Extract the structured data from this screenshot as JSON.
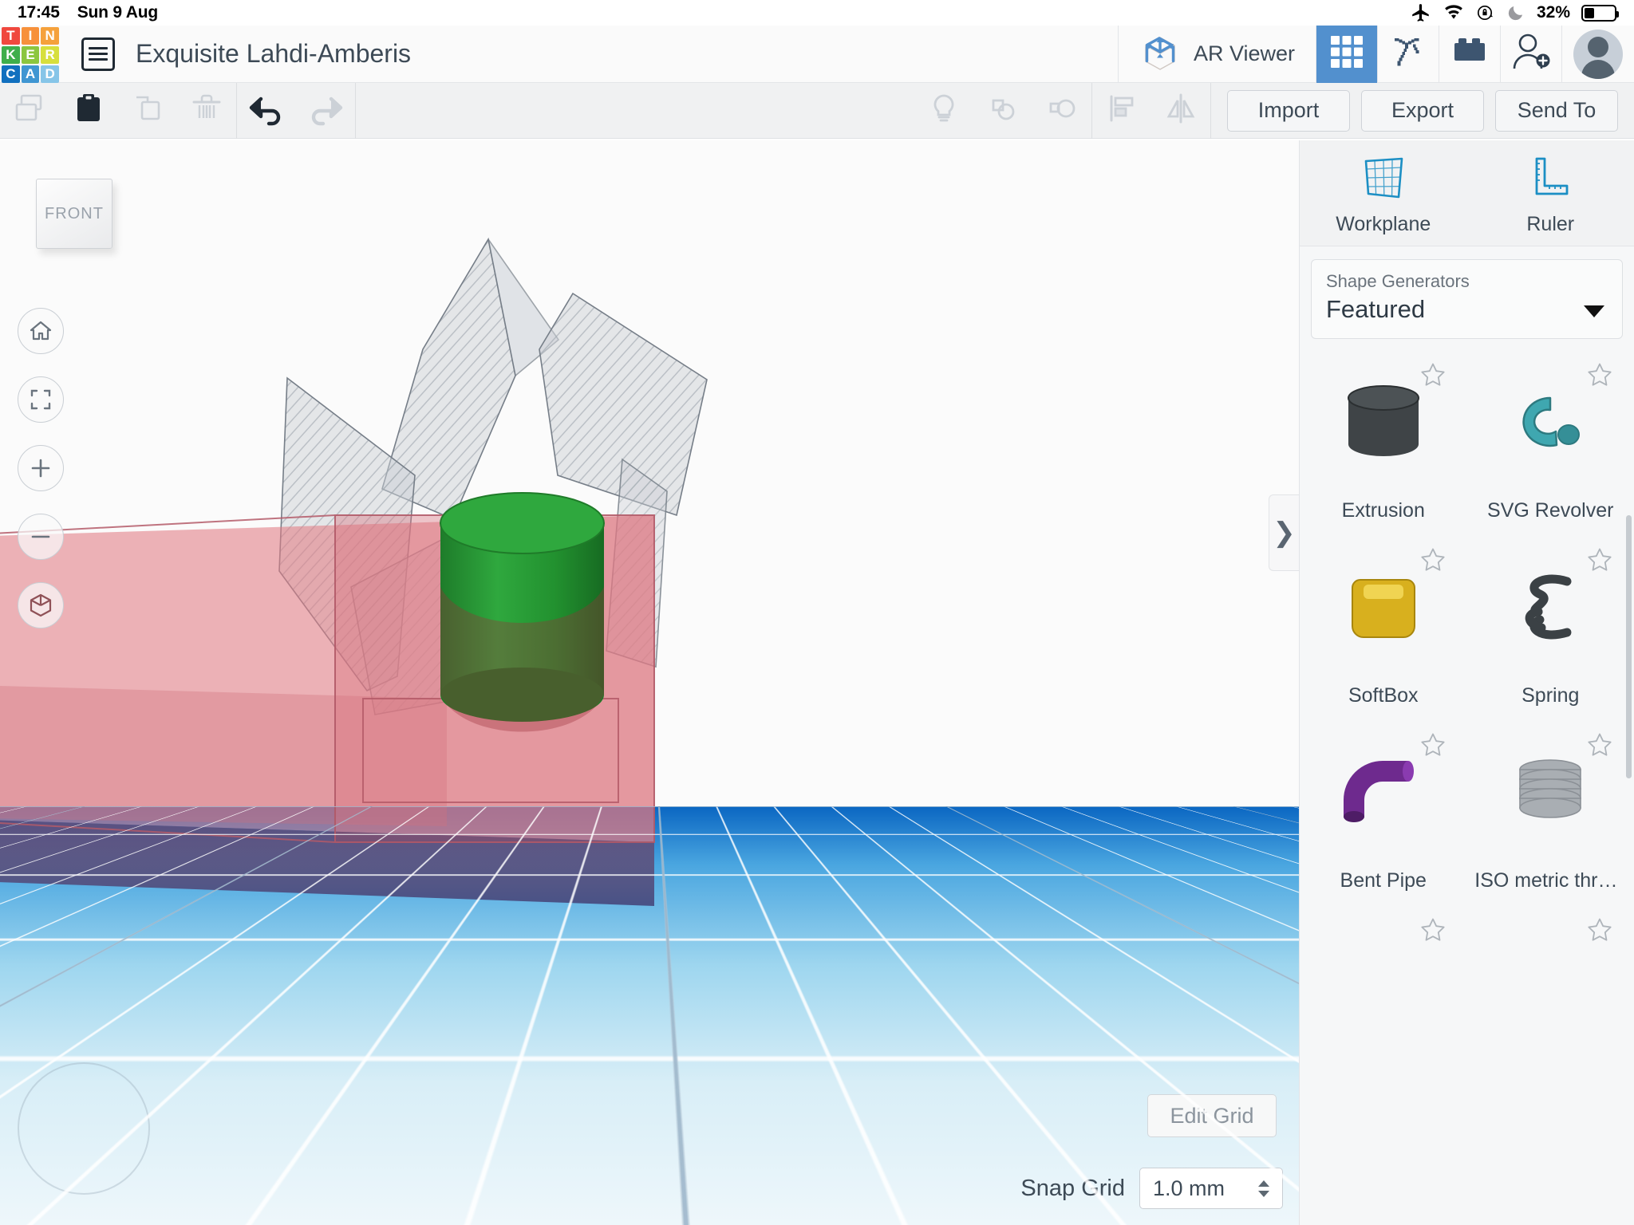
{
  "statusbar": {
    "time": "17:45",
    "date": "Sun 9 Aug",
    "battery_percent": "32%",
    "icons": [
      "airplane-mode-icon",
      "wifi-icon",
      "rotation-lock-icon",
      "do-not-disturb-icon",
      "battery-icon"
    ]
  },
  "header": {
    "logo_letters": [
      "T",
      "I",
      "N",
      "K",
      "E",
      "R",
      "C",
      "A",
      "D"
    ],
    "logo_colors": [
      "#f0483e",
      "#f7913b",
      "#f5a13c",
      "#3fae4b",
      "#8cc63f",
      "#d7df3d",
      "#1170bf",
      "#3f96d2",
      "#86c5e8"
    ],
    "menu_icon": "list-menu-icon",
    "title": "Exquisite Lahdi-Amberis",
    "ar_viewer_label": "AR Viewer",
    "modes": [
      {
        "name": "3d-design-mode",
        "icon": "grid-3x3-icon",
        "active": true
      },
      {
        "name": "minecraft-mode",
        "icon": "pickaxe-icon",
        "active": false
      },
      {
        "name": "blocks-mode",
        "icon": "lego-brick-icon",
        "active": false
      }
    ],
    "invite_icon": "add-person-icon",
    "avatar": "user-avatar"
  },
  "toolbar": {
    "left_icons": [
      {
        "name": "copy-icon",
        "enabled": false
      },
      {
        "name": "paste-icon",
        "enabled": true
      },
      {
        "name": "duplicate-icon",
        "enabled": false
      },
      {
        "name": "delete-icon",
        "enabled": false
      }
    ],
    "history_icons": [
      {
        "name": "undo-icon",
        "enabled": true
      },
      {
        "name": "redo-icon",
        "enabled": false
      }
    ],
    "mid_icons": [
      {
        "name": "light-bulb-icon",
        "enabled": false
      },
      {
        "name": "group-icon",
        "enabled": false
      },
      {
        "name": "ungroup-icon",
        "enabled": false
      }
    ],
    "align_icons": [
      {
        "name": "align-icon",
        "enabled": false
      },
      {
        "name": "mirror-icon",
        "enabled": false
      }
    ],
    "actions": [
      "Import",
      "Export",
      "Send To"
    ]
  },
  "viewport": {
    "view_cube_label": "FRONT",
    "nav_buttons": [
      {
        "name": "home-view-button",
        "icon": "home-icon"
      },
      {
        "name": "fit-to-view-button",
        "icon": "fit-frame-icon"
      },
      {
        "name": "zoom-in-button",
        "icon": "plus-icon"
      },
      {
        "name": "zoom-out-button",
        "icon": "minus-icon"
      },
      {
        "name": "perspective-toggle-button",
        "icon": "cube-icon"
      }
    ],
    "edit_grid_label": "Edit Grid",
    "snap_grid_label": "Snap Grid",
    "snap_grid_value": "1.0 mm",
    "panel_handle_icon": "chevron-right-icon",
    "shapes": [
      {
        "name": "red-box-solid",
        "color": "#e27c84"
      },
      {
        "name": "green-cylinder",
        "color": "#2e9b3c"
      },
      {
        "name": "grey-hole-shapes",
        "color": "#b9bfc6"
      }
    ]
  },
  "right_panel": {
    "tools": [
      {
        "label": "Workplane",
        "icon": "workplane-icon"
      },
      {
        "label": "Ruler",
        "icon": "ruler-icon"
      }
    ],
    "selector": {
      "caption": "Shape Generators",
      "value": "Featured",
      "caret": "chevron-down-icon"
    },
    "shapes": [
      {
        "label": "Extrusion",
        "icon": "extrusion-cylinder-thumb",
        "color": "#3f4447",
        "starred": false
      },
      {
        "label": "SVG Revolver",
        "icon": "svg-revolver-thumb",
        "color": "#3fa7b0",
        "starred": false
      },
      {
        "label": "SoftBox",
        "icon": "softbox-thumb",
        "color": "#d8b01e",
        "starred": false
      },
      {
        "label": "Spring",
        "icon": "spring-thumb",
        "color": "#3b4145",
        "starred": false
      },
      {
        "label": "Bent Pipe",
        "icon": "bent-pipe-thumb",
        "color": "#6e2a8e",
        "starred": false
      },
      {
        "label": "ISO metric thre…",
        "icon": "iso-metric-thread-thumb",
        "color": "#a9aeb3",
        "starred": false
      }
    ],
    "star_icon": "star-outline-icon"
  },
  "colors": {
    "accent_blue": "#5290ce",
    "panel_bg": "#f6f7f8",
    "text_dark": "#3d4a56",
    "tinkercad_cyan": "#1c8fc4"
  }
}
